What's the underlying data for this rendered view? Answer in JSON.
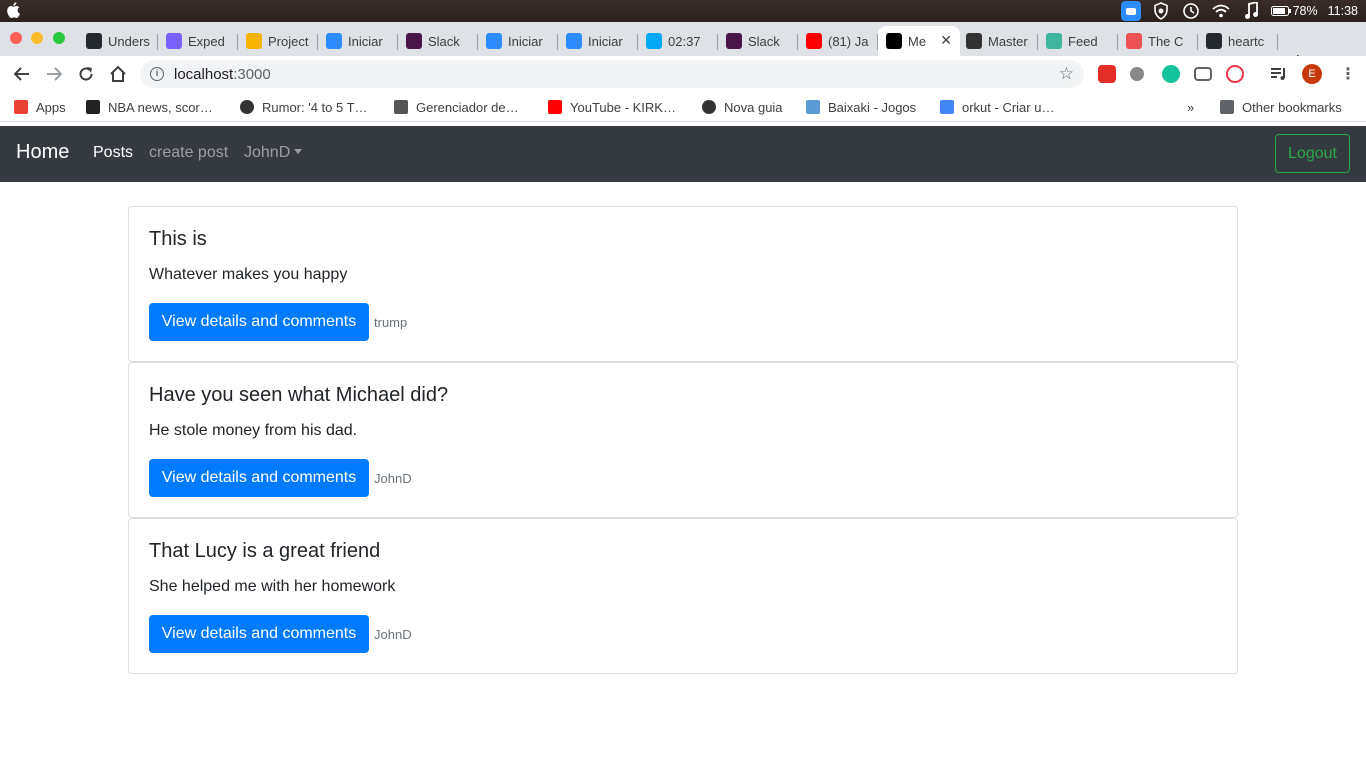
{
  "menubar": {
    "battery": "78%",
    "time": "11:38"
  },
  "browser": {
    "tabs": [
      {
        "label": "Unders",
        "icon": "github-icon",
        "color": "#24292e"
      },
      {
        "label": "Exped",
        "icon": "expedia-icon",
        "color": "#7b61ff"
      },
      {
        "label": "Project",
        "icon": "project-icon",
        "color": "#f4b400"
      },
      {
        "label": "Iniciar",
        "icon": "zoom-icon",
        "color": "#2d8cff"
      },
      {
        "label": "Slack",
        "icon": "slack-icon",
        "color": "#4a154b"
      },
      {
        "label": "Iniciar",
        "icon": "zoom-icon",
        "color": "#2d8cff"
      },
      {
        "label": "Iniciar",
        "icon": "zoom-icon",
        "color": "#2d8cff"
      },
      {
        "label": "02:37",
        "icon": "clockify-icon",
        "color": "#03a9f4"
      },
      {
        "label": "Slack",
        "icon": "slack-icon",
        "color": "#4a154b"
      },
      {
        "label": "(81) Ja",
        "icon": "youtube-icon",
        "color": "#ff0000"
      },
      {
        "label": "Me",
        "icon": "app-icon",
        "color": "#000000",
        "active": true
      },
      {
        "label": "Master",
        "icon": "master-icon",
        "color": "#333333"
      },
      {
        "label": "Feed",
        "icon": "feed-icon",
        "color": "#3fb59d"
      },
      {
        "label": "The C",
        "icon": "udemy-icon",
        "color": "#ec5252"
      },
      {
        "label": "heartc",
        "icon": "github-icon",
        "color": "#24292e"
      }
    ],
    "url_host": "localhost",
    "url_port": ":3000",
    "bookmarks": [
      {
        "label": "Apps",
        "icon": "apps-grid-icon"
      },
      {
        "label": "NBA news, scor…",
        "icon": "br-icon"
      },
      {
        "label": "Rumor: '4 to 5 T…",
        "icon": "globe-icon"
      },
      {
        "label": "Gerenciador de…",
        "icon": "manager-icon"
      },
      {
        "label": "YouTube - KIRK…",
        "icon": "youtube-icon"
      },
      {
        "label": "Nova guia",
        "icon": "globe-icon"
      },
      {
        "label": "Baixaki - Jogos",
        "icon": "baixaki-icon"
      },
      {
        "label": "orkut - Criar u…",
        "icon": "google-icon"
      }
    ],
    "other_bookmarks": "Other bookmarks",
    "overflow": "»",
    "avatar_letter": "E"
  },
  "navbar": {
    "brand": "Home",
    "posts": "Posts",
    "create_post": "create post",
    "user": "JohnD",
    "logout": "Logout"
  },
  "posts": [
    {
      "title": "This is",
      "body": "Whatever makes you happy",
      "button": "View details and comments",
      "author": "trump"
    },
    {
      "title": "Have you seen what Michael did?",
      "body": "He stole money from his dad.",
      "button": "View details and comments",
      "author": "JohnD"
    },
    {
      "title": "That Lucy is a great friend",
      "body": "She helped me with her homework",
      "button": "View details and comments",
      "author": "JohnD"
    }
  ]
}
